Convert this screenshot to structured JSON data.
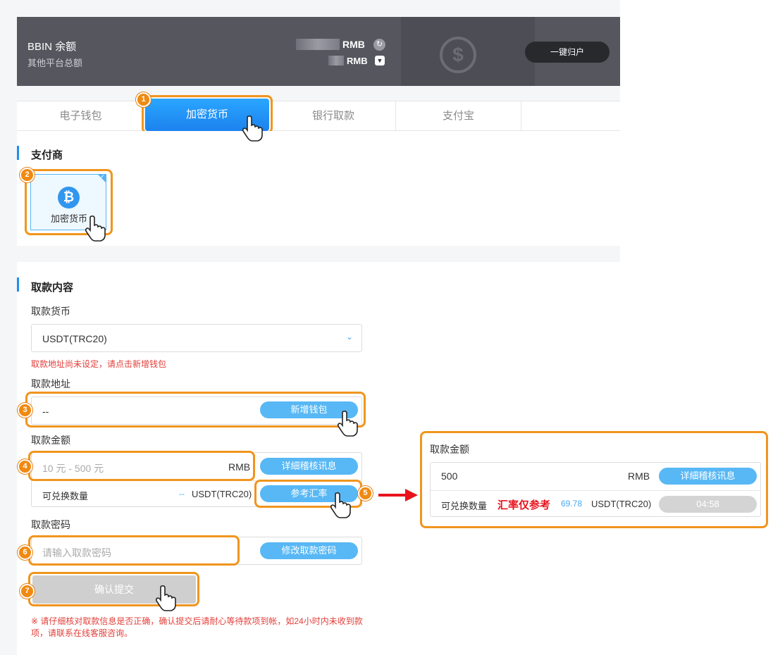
{
  "header": {
    "title": "BBIN 余额",
    "subtitle": "其他平台总额",
    "currency_main": "RMB",
    "currency_sub": "RMB",
    "recall_button": "一键归户",
    "coin_symbol": "$"
  },
  "tabs": [
    {
      "label": "电子钱包"
    },
    {
      "label": "加密货币"
    },
    {
      "label": "银行取款"
    },
    {
      "label": "支付宝"
    }
  ],
  "providers": {
    "title": "支付商",
    "items": [
      {
        "label": "加密货币",
        "icon": "bitcoin-icon",
        "glyph": "₿"
      }
    ]
  },
  "withdraw": {
    "title": "取款内容",
    "currency_label": "取款货币",
    "currency_value": "USDT(TRC20)",
    "address_error": "取款地址尚未设定，请点击新增钱包",
    "address_label": "取款地址",
    "address_value": "--",
    "add_wallet_button": "新增钱包",
    "amount_label": "取款金额",
    "amount_placeholder": "10 元 - 500 元",
    "amount_unit": "RMB",
    "detail_button": "详細稽核讯息",
    "exchange_label": "可兑换数量",
    "exchange_value": "--",
    "exchange_unit": "USDT(TRC20)",
    "rate_button": "参考汇率",
    "password_label": "取款密码",
    "password_placeholder": "请输入取款密码",
    "change_password_button": "修改取款密码",
    "submit_button": "确认提交",
    "note": "※ 请仔细核对取款信息是否正确，确认提交后请耐心等待款项到帐，如24小时内未收到款项，请联系在线客服咨询。"
  },
  "popup": {
    "title": "取款金额",
    "amount_value": "500",
    "amount_unit": "RMB",
    "detail_button": "详細稽核讯息",
    "exchange_label": "可兑换数量",
    "rate_note": "汇率仅参考",
    "exchange_value": "69.78",
    "exchange_unit": "USDT(TRC20)",
    "timer": "04:58"
  },
  "steps": [
    "1",
    "2",
    "3",
    "4",
    "5",
    "6",
    "7"
  ],
  "colors": {
    "accent": "#1f8ff0",
    "pill": "#58b8f5",
    "highlight": "#f0951e",
    "error": "#e2403b",
    "arrow": "#e8131c"
  }
}
